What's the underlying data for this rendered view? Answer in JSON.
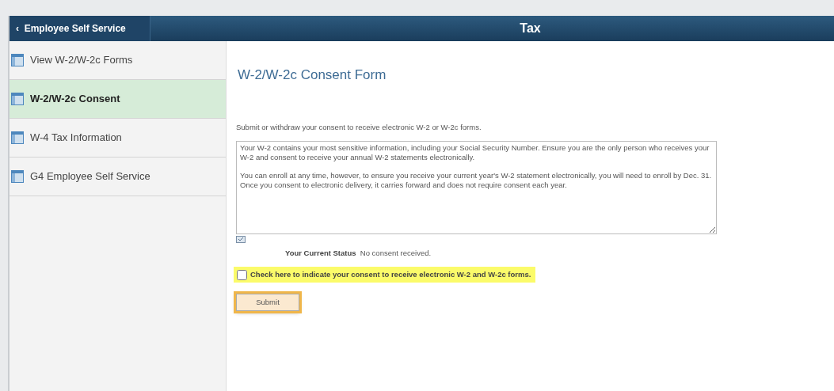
{
  "header": {
    "back_label": "Employee Self Service",
    "back_icon": "‹",
    "title": "Tax"
  },
  "sidebar": {
    "items": [
      {
        "label": "View W-2/W-2c Forms",
        "selected": false
      },
      {
        "label": "W-2/W-2c Consent",
        "selected": true
      },
      {
        "label": "W-4 Tax Information",
        "selected": false
      },
      {
        "label": "G4 Employee Self Service",
        "selected": false
      }
    ]
  },
  "content": {
    "title": "W-2/W-2c Consent Form",
    "instructions": "Submit or withdraw your consent to receive electronic W-2 or W-2c forms.",
    "notice_paragraphs": [
      "Your W-2 contains your most sensitive information, including your Social Security Number. Ensure you are the only person who receives your W-2 and consent to receive your annual W-2 statements electronically.",
      "You can enroll at any time, however, to ensure you receive your current year's W-2 statement electronically, you will need to enroll by Dec. 31. Once you consent to electronic delivery, it carries forward and does not require consent each year."
    ],
    "status_label": "Your Current Status",
    "status_value": "No consent received.",
    "consent": {
      "label": "Check here to indicate your consent to receive electronic W-2 and W-2c forms.",
      "checked": false,
      "highlighted": true
    },
    "submit": {
      "label": "Submit",
      "highlighted": true
    }
  }
}
